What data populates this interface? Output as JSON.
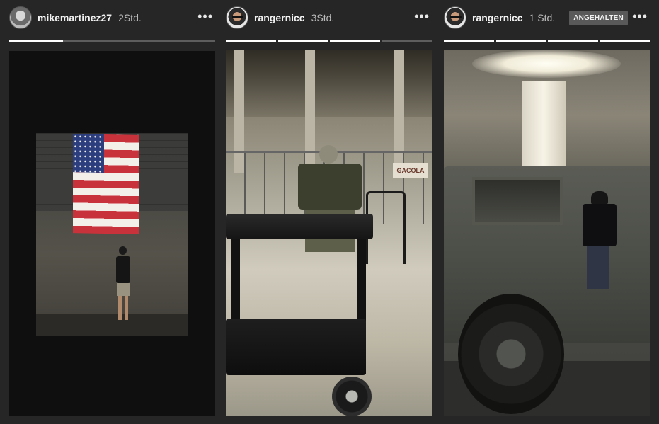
{
  "stories": [
    {
      "username": "mikemartinez27",
      "time": "2Std.",
      "paused_label": "",
      "progress_filled": [
        0.3
      ],
      "segments": 1
    },
    {
      "username": "rangernicc",
      "time": "3Std.",
      "paused_label": "",
      "progress_filled": [
        1,
        1,
        1,
        0
      ],
      "segments": 4
    },
    {
      "username": "rangernicc",
      "time": "1 Std.",
      "paused_label": "ANGEHALTEN",
      "progress_filled": [
        1,
        1,
        1,
        1
      ],
      "segments": 4
    }
  ],
  "story2_sign_text": "GACOLA",
  "icons": {
    "more": "more-options-icon"
  },
  "colors": {
    "background": "#262626",
    "progress_track": "#5e5e5e",
    "progress_fill": "#ffffff",
    "paused_badge": "#595959"
  }
}
